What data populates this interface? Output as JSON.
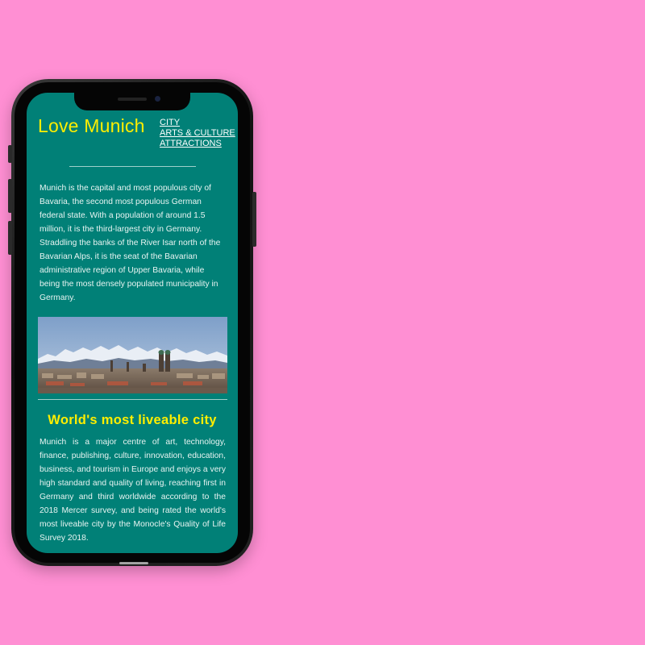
{
  "site": {
    "logo": "Love Munich",
    "nav": [
      "CITY",
      "ARTS & CULTURE",
      "ATTRACTIONS"
    ]
  },
  "intro": "Munich is the capital and most populous city of Bavaria, the second most populous German federal state. With a population of around 1.5 million, it is the third-largest city in Germany. Straddling the banks of the River Isar north of the Bavarian Alps, it is the seat of the Bavarian administrative region of Upper Bavaria, while being the most densely populated municipality in Germany.",
  "section": {
    "title": "World's most liveable city",
    "body": "Munich is a major centre of art, technology, finance, publishing, culture, innovation, education, business, and tourism in Europe and enjoys a very high standard and quality of living, reaching first in Germany and third worldwide according to the 2018 Mercer survey, and being rated the world's most liveable city by the Monocle's Quality of Life Survey 2018."
  },
  "colors": {
    "background": "#ff8fd3",
    "screen": "#018077",
    "accent": "#ffee00"
  },
  "image": {
    "subject": "munich-skyline-with-alps"
  }
}
